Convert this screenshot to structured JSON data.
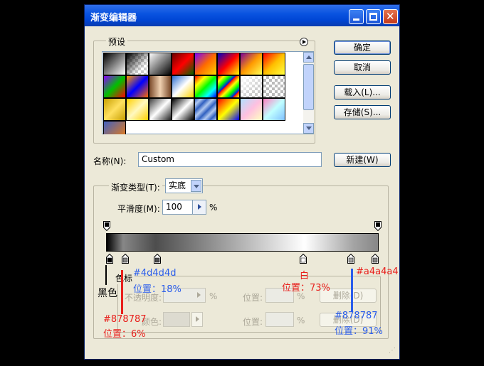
{
  "window": {
    "title": "渐变编辑器"
  },
  "titlebar_buttons": [
    "minimize-icon",
    "maximize-icon",
    "close-icon"
  ],
  "presets": {
    "label": "预设",
    "swatches": [
      "linear-gradient(135deg,#000,#fff)",
      "checker-black",
      "linear-gradient(135deg,#fff,#000)",
      "linear-gradient(135deg,#6a0000,#ff0000,#006400)",
      "linear-gradient(135deg,#7a00ff,#ff6a00,#ffd400)",
      "linear-gradient(135deg,#0000c8,#ff0000,#ffff00)",
      "linear-gradient(135deg,#7b0099,#ff9a00,#ffff55)",
      "linear-gradient(135deg,#ff0000,#ffc000,#ffff40)",
      "linear-gradient(135deg,#8a00ff,#00c000,#ff0000)",
      "linear-gradient(135deg,#ff9a00,#0000ff,#ff6a00)",
      "linear-gradient(90deg,#7a4a2a,#f0d0b0,#7a4a2a)",
      "linear-gradient(135deg,#2a6cd0,#fff,#ffd400)",
      "linear-gradient(135deg,#ff0000,#ffff00,#00ff00,#00ffff,#0000ff)",
      "repeating-linear-gradient(135deg,#ff0000 0,#ffff00 6px,#00ff00 12px,#0000ff 18px)",
      "checker-white",
      "checker-gray",
      "linear-gradient(135deg,#c8a000,#ffe060,#c8a000)",
      "linear-gradient(135deg,#ffd000,#fff8c0,#ffd000)",
      "linear-gradient(135deg,#404040,#ffffff,#202020)",
      "linear-gradient(135deg,#000,#fff,#000)",
      "repeating-linear-gradient(135deg,#3060c0 0,#b0c8f0 6px,#3060c0 12px)",
      "linear-gradient(135deg,#ff0000,#ffff00,#0000ff)",
      "linear-gradient(135deg,#b0e0ff,#ffc0e0,#ffffc0)",
      "linear-gradient(135deg,#ff80c0,#c0ffff,#80c0ff)",
      "linear-gradient(135deg,#4060c0,#ff8000)"
    ]
  },
  "buttons": {
    "ok": "确定",
    "cancel": "取消",
    "load": "载入(L)...",
    "save": "存储(S)...",
    "new": "新建(W)",
    "delete1": "删除(D)",
    "delete2": "删除(D)"
  },
  "name": {
    "label": "名称(N):",
    "value": "Custom"
  },
  "gradient_type": {
    "label": "渐变类型(T):",
    "value": "实底"
  },
  "smoothness": {
    "label": "平滑度(M):",
    "value": "100",
    "unit": "%"
  },
  "stops_group": {
    "label": "色标",
    "opacity_label": "不透明度:",
    "opacity_unit": "%",
    "position_label1": "位置:",
    "position_unit1": "%",
    "color_label": "颜色:",
    "position_label2": "位置:",
    "position_unit2": "%"
  },
  "gradient_bar": {
    "gradient": "linear-gradient(to right,#000000 0%,#878787 6%,#4d4d4d 18%,#ffffff 73%,#a4a4a4 91%,#878787 100%)"
  },
  "color_stops": [
    {
      "position": 0,
      "color": "#000000"
    },
    {
      "position": 6,
      "color": "#878787"
    },
    {
      "position": 18,
      "color": "#4d4d4d"
    },
    {
      "position": 73,
      "color": "#ffffff"
    },
    {
      "position": 91,
      "color": "#a4a4a4"
    },
    {
      "position": 100,
      "color": "#878787"
    }
  ],
  "opacity_stops": [
    0,
    100
  ],
  "annotations": {
    "black_label": "黑色",
    "red1": "#878787",
    "red1_pos": "位置：6%",
    "blue1": "#4d4d4d",
    "blue1_pos": "位置：18%",
    "white_label": "白",
    "white_pos": "位置：73%",
    "red2": "#a4a4a4",
    "blue2": "#878787",
    "blue2_pos": "位置：91%"
  },
  "colors": {
    "annotation_red": "#E8201C",
    "annotation_blue": "#2A5DEB"
  }
}
